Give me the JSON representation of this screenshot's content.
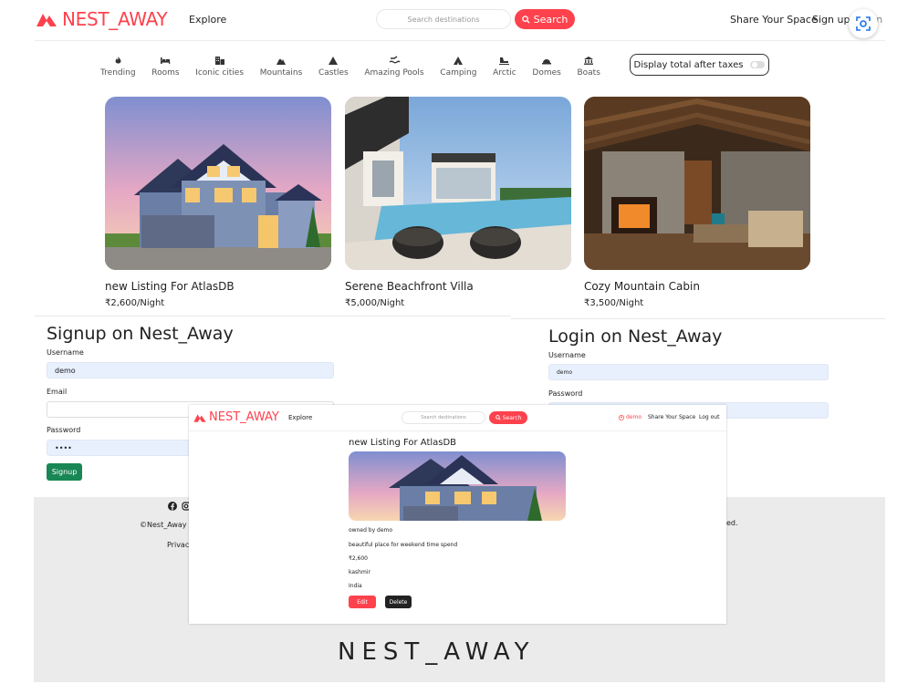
{
  "colors": {
    "brand": "#fe424d",
    "signup": "#198754",
    "footer_bg": "#ebebeb",
    "input_bg": "#e8f0fe"
  },
  "navbar": {
    "brand": "NEST_AWAY",
    "explore": "Explore",
    "search_placeholder": "Search destinations",
    "search_button": "Search",
    "share": "Share Your Space",
    "signup": "Sign up",
    "login": "Log in"
  },
  "filters": [
    {
      "label": "Trending",
      "icon": "fire-icon"
    },
    {
      "label": "Rooms",
      "icon": "bed-icon"
    },
    {
      "label": "Iconic cities",
      "icon": "city-icon"
    },
    {
      "label": "Mountains",
      "icon": "mountain-icon"
    },
    {
      "label": "Castles",
      "icon": "castle-icon"
    },
    {
      "label": "Amazing Pools",
      "icon": "pool-icon"
    },
    {
      "label": "Camping",
      "icon": "tent-icon"
    },
    {
      "label": "Arctic",
      "icon": "snowmobile-icon"
    },
    {
      "label": "Domes",
      "icon": "dome-icon"
    },
    {
      "label": "Boats",
      "icon": "boat-icon"
    }
  ],
  "tax_toggle": {
    "label": "Display total after taxes"
  },
  "listings": [
    {
      "title": "new Listing For AtlasDB",
      "price": "₹2,600/Night"
    },
    {
      "title": "Serene Beachfront Villa",
      "price": "₹5,000/Night"
    },
    {
      "title": "Cozy Mountain Cabin",
      "price": "₹3,500/Night"
    }
  ],
  "signup_form": {
    "title": "Signup on Nest_Away",
    "username_label": "Username",
    "username_value": "demo",
    "email_label": "Email",
    "password_label": "Password",
    "password_value": "••••",
    "button": "Signup"
  },
  "login_form": {
    "title": "Login on Nest_Away",
    "username_label": "Username",
    "username_value": "demo",
    "password_label": "Password"
  },
  "footer": {
    "copyright": "©Nest_Away P",
    "privacy": "Privacy",
    "rights_tail": "ed.",
    "logo": "NEST_AWAY"
  },
  "overlay": {
    "brand": "NEST_AWAY",
    "explore": "Explore",
    "search_placeholder": "Search destinations",
    "search_button": "Search",
    "user": "demo",
    "share": "Share Your Space",
    "logout": "Log out",
    "listing_title": "new Listing For AtlasDB",
    "owner": "owned by demo",
    "description": "beautiful place for weekend time spend",
    "price": "₹2,600",
    "location": "kashmir",
    "country": "India",
    "edit": "Edit",
    "delete": "Delete"
  }
}
